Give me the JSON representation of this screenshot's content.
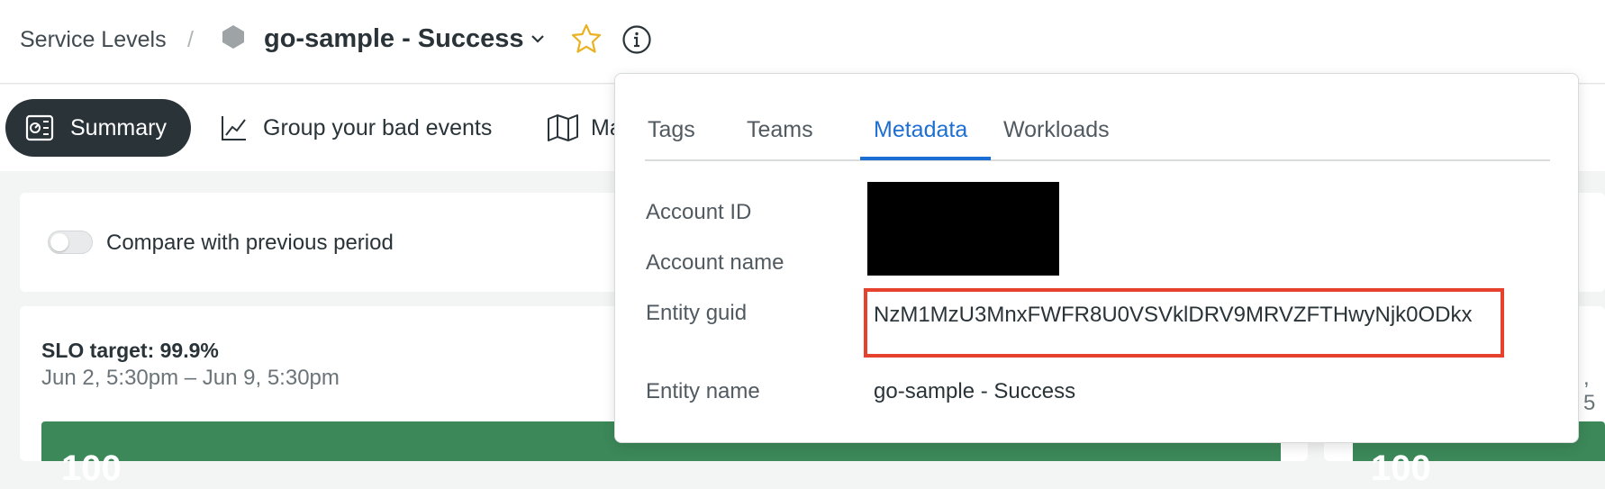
{
  "header": {
    "breadcrumb": "Service Levels",
    "separator": "/",
    "entity_title": "go-sample - Success",
    "icons": [
      "hexagon-entity-icon",
      "chevron-down-icon",
      "star-icon",
      "info-icon"
    ]
  },
  "tabs": [
    {
      "label": "Summary",
      "icon": "dashboard-icon",
      "active": true
    },
    {
      "label": "Group your bad events",
      "icon": "line-chart-icon"
    },
    {
      "label": "Ma",
      "icon": "map-icon"
    }
  ],
  "compare": {
    "label": "Compare with previous period",
    "enabled": false
  },
  "slo": {
    "target": "SLO target: 99.9%",
    "range": "Jun 2, 5:30pm – Jun 9, 5:30pm",
    "right_fragment": ", 5",
    "big_value_left": "100",
    "big_value_right": "100"
  },
  "popover": {
    "tabs": [
      "Tags",
      "Teams",
      "Metadata",
      "Workloads"
    ],
    "active_tab": "Metadata",
    "fields": {
      "account_id_label": "Account ID",
      "account_name_label": "Account name",
      "entity_guid_label": "Entity guid",
      "entity_guid_value": "NzM1MzU3MnxFWFR8U0VSVklDRV9MRVZFTHwyNjk0ODkx",
      "entity_name_label": "Entity name",
      "entity_name_value": "go-sample - Success"
    }
  },
  "colors": {
    "accent": "#1d6fd3",
    "pill": "#293338",
    "highlight": "#e5412d",
    "success_green": "#3c8859",
    "star": "#e8b220"
  }
}
